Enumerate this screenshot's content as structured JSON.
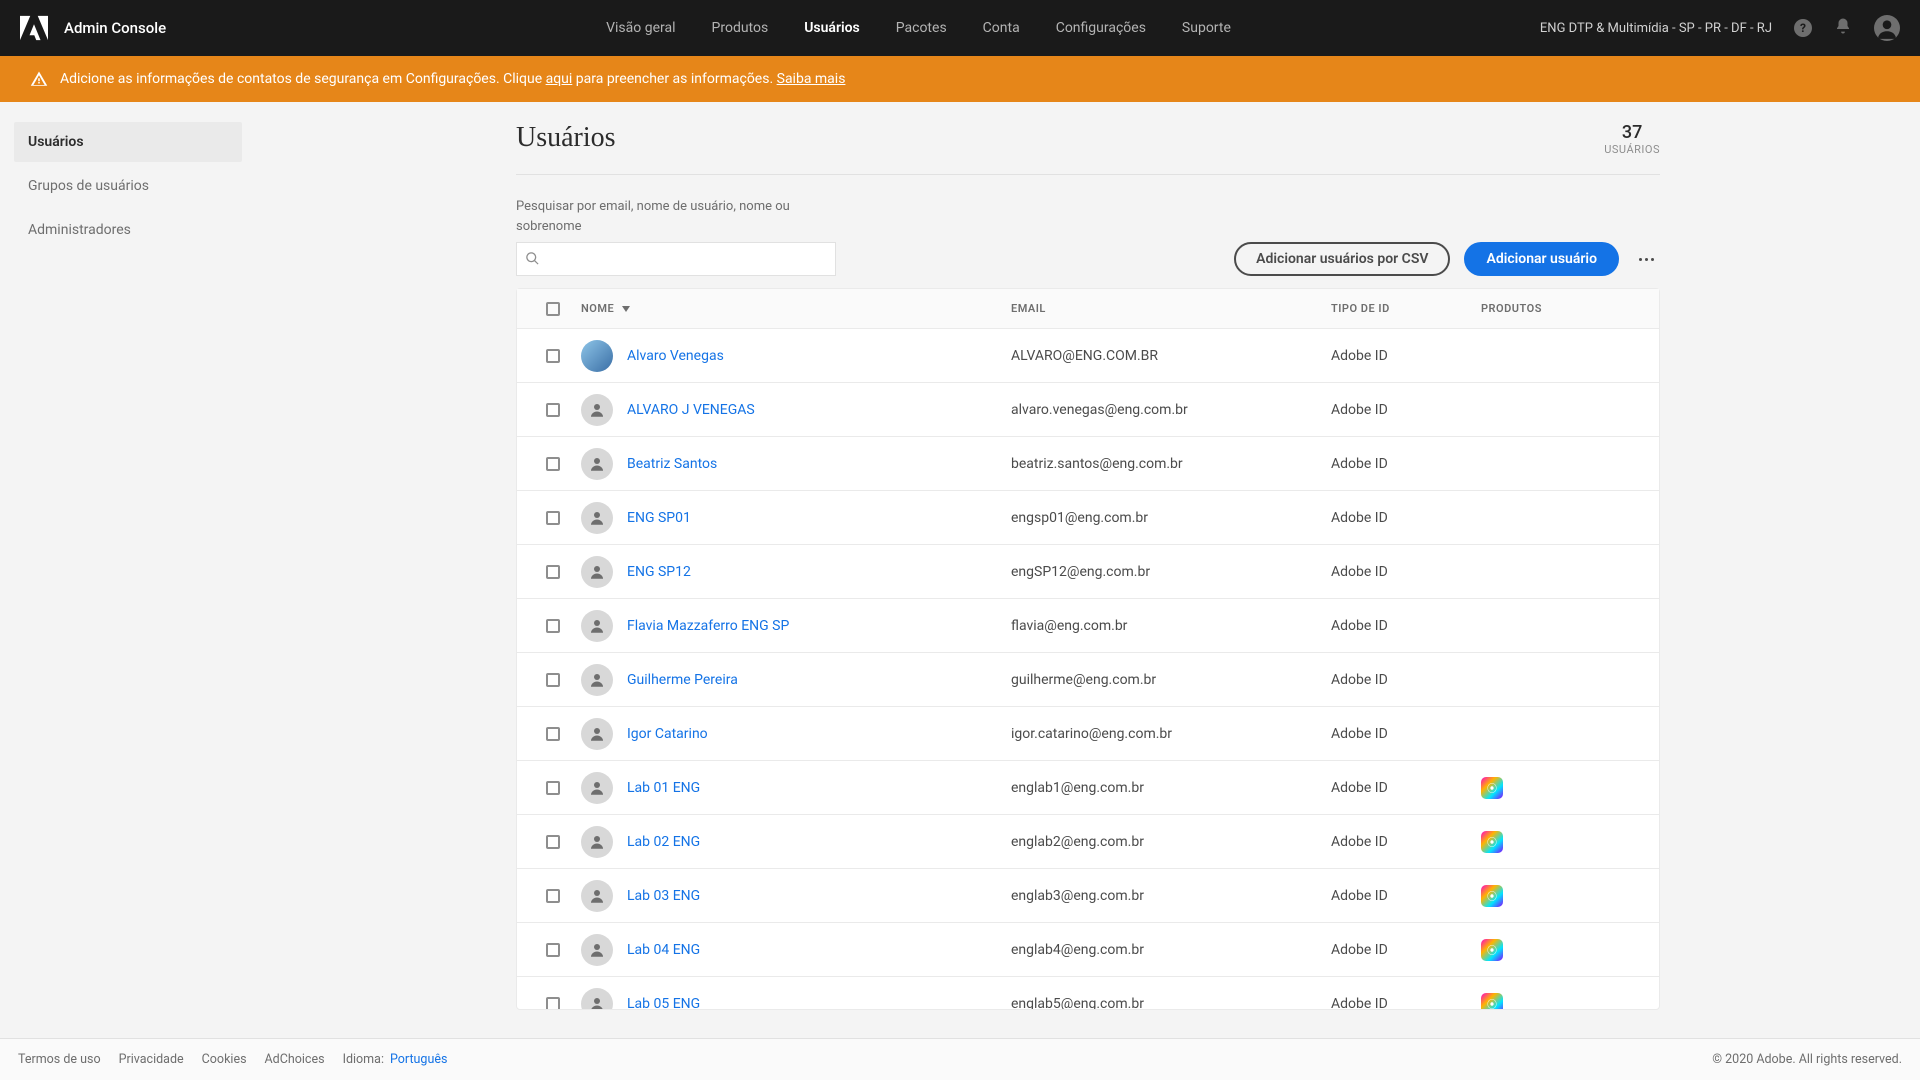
{
  "header": {
    "app_title": "Admin Console",
    "nav": [
      "Visão geral",
      "Produtos",
      "Usuários",
      "Pacotes",
      "Conta",
      "Configurações",
      "Suporte"
    ],
    "nav_active_index": 2,
    "org_label": "ENG DTP & Multimídia - SP - PR - DF - RJ"
  },
  "alert": {
    "prefix": "Adicione as informações de contatos de segurança em Configurações. Clique ",
    "link1": "aqui",
    "middle": " para preencher as informações. ",
    "link2": "Saiba mais"
  },
  "sidebar": {
    "items": [
      "Usuários",
      "Grupos de usuários",
      "Administradores"
    ],
    "active_index": 0
  },
  "page": {
    "title": "Usuários",
    "count_value": "37",
    "count_label": "USUÁRIOS",
    "search_label": "Pesquisar por email, nome de usuário, nome ou sobrenome",
    "btn_csv": "Adicionar usuários por CSV",
    "btn_add": "Adicionar usuário"
  },
  "table": {
    "cols": {
      "name": "NOME",
      "email": "EMAIL",
      "idtype": "TIPO DE ID",
      "products": "PRODUTOS"
    },
    "rows": [
      {
        "name": "Alvaro Venegas",
        "email": "ALVARO@ENG.COM.BR",
        "idtype": "Adobe ID",
        "prod": false,
        "photo": true
      },
      {
        "name": "ALVARO J VENEGAS",
        "email": "alvaro.venegas@eng.com.br",
        "idtype": "Adobe ID",
        "prod": false,
        "photo": false
      },
      {
        "name": "Beatriz Santos",
        "email": "beatriz.santos@eng.com.br",
        "idtype": "Adobe ID",
        "prod": false,
        "photo": false
      },
      {
        "name": "ENG SP01",
        "email": "engsp01@eng.com.br",
        "idtype": "Adobe ID",
        "prod": false,
        "photo": false
      },
      {
        "name": "ENG SP12",
        "email": "engSP12@eng.com.br",
        "idtype": "Adobe ID",
        "prod": false,
        "photo": false
      },
      {
        "name": "Flavia Mazzaferro ENG SP",
        "email": "flavia@eng.com.br",
        "idtype": "Adobe ID",
        "prod": false,
        "photo": false
      },
      {
        "name": "Guilherme Pereira",
        "email": "guilherme@eng.com.br",
        "idtype": "Adobe ID",
        "prod": false,
        "photo": false
      },
      {
        "name": "Igor Catarino",
        "email": "igor.catarino@eng.com.br",
        "idtype": "Adobe ID",
        "prod": false,
        "photo": false
      },
      {
        "name": "Lab 01 ENG",
        "email": "englab1@eng.com.br",
        "idtype": "Adobe ID",
        "prod": true,
        "photo": false
      },
      {
        "name": "Lab 02 ENG",
        "email": "englab2@eng.com.br",
        "idtype": "Adobe ID",
        "prod": true,
        "photo": false
      },
      {
        "name": "Lab 03 ENG",
        "email": "englab3@eng.com.br",
        "idtype": "Adobe ID",
        "prod": true,
        "photo": false
      },
      {
        "name": "Lab 04 ENG",
        "email": "englab4@eng.com.br",
        "idtype": "Adobe ID",
        "prod": true,
        "photo": false
      },
      {
        "name": "Lab 05 ENG",
        "email": "englab5@eng.com.br",
        "idtype": "Adobe ID",
        "prod": true,
        "photo": false
      }
    ]
  },
  "footer": {
    "links": [
      "Termos de uso",
      "Privacidade",
      "Cookies",
      "AdChoices"
    ],
    "lang_label": "Idioma:",
    "lang_value": "Português",
    "copyright": "© 2020 Adobe. All rights reserved."
  }
}
